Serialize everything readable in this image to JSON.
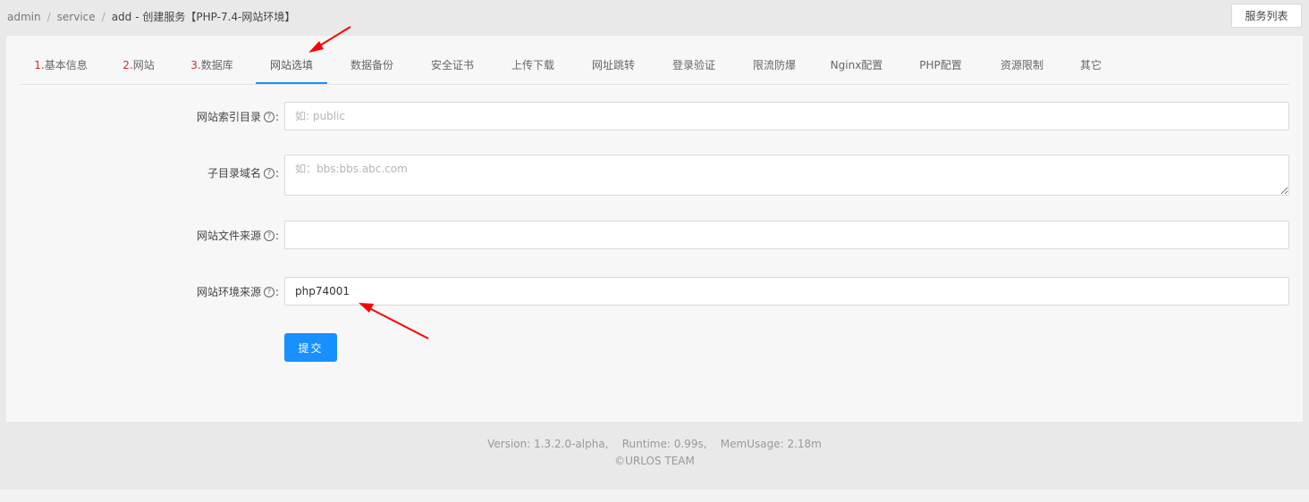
{
  "breadcrumb": {
    "items": [
      "admin",
      "service",
      "add"
    ],
    "title": "- 创建服务【PHP-7.4-网站环境】"
  },
  "header": {
    "service_list_label": "服务列表"
  },
  "tabs": [
    {
      "num": "1.",
      "label": "基本信息"
    },
    {
      "num": "2.",
      "label": "网站"
    },
    {
      "num": "3.",
      "label": "数据库"
    },
    {
      "num": "",
      "label": "网站选填",
      "active": true
    },
    {
      "num": "",
      "label": "数据备份"
    },
    {
      "num": "",
      "label": "安全证书"
    },
    {
      "num": "",
      "label": "上传下载"
    },
    {
      "num": "",
      "label": "网址跳转"
    },
    {
      "num": "",
      "label": "登录验证"
    },
    {
      "num": "",
      "label": "限流防爆"
    },
    {
      "num": "",
      "label": "Nginx配置"
    },
    {
      "num": "",
      "label": "PHP配置"
    },
    {
      "num": "",
      "label": "资源限制"
    },
    {
      "num": "",
      "label": "其它"
    }
  ],
  "form": {
    "index_dir": {
      "label": "网站索引目录",
      "placeholder": "如: public",
      "value": ""
    },
    "subdomain": {
      "label": "子目录域名",
      "placeholder": "如：bbs:bbs.abc.com",
      "value": ""
    },
    "file_source": {
      "label": "网站文件来源",
      "placeholder": "",
      "value": ""
    },
    "env_source": {
      "label": "网站环境来源",
      "placeholder": "",
      "value": "php74001"
    },
    "help_glyph": "?",
    "colon": ":",
    "submit_label": "提交"
  },
  "footer": {
    "line1": "Version: 1.3.2.0-alpha,    Runtime: 0.99s,    MemUsage: 2.18m",
    "line2": "©URLOS TEAM"
  },
  "colors": {
    "accent": "#1890ff",
    "annotation": "#ff0000",
    "tab_number": "#c9302c"
  }
}
